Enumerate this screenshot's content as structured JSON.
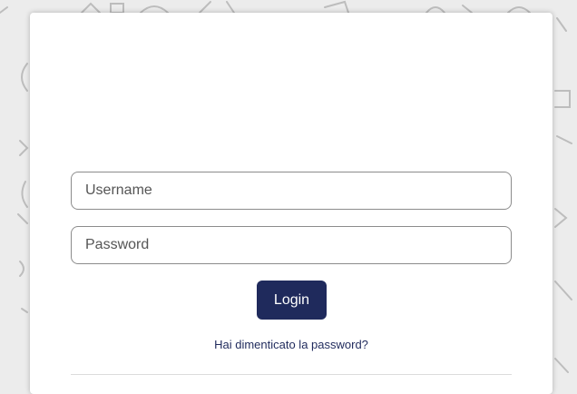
{
  "login_form": {
    "username_placeholder": "Username",
    "password_placeholder": "Password",
    "login_label": "Login",
    "forgot_password": "Hai dimenticato la password?"
  },
  "colors": {
    "button_background": "#1f2a5c",
    "link": "#1f2a5c",
    "field_border": "#8c8c8c"
  }
}
